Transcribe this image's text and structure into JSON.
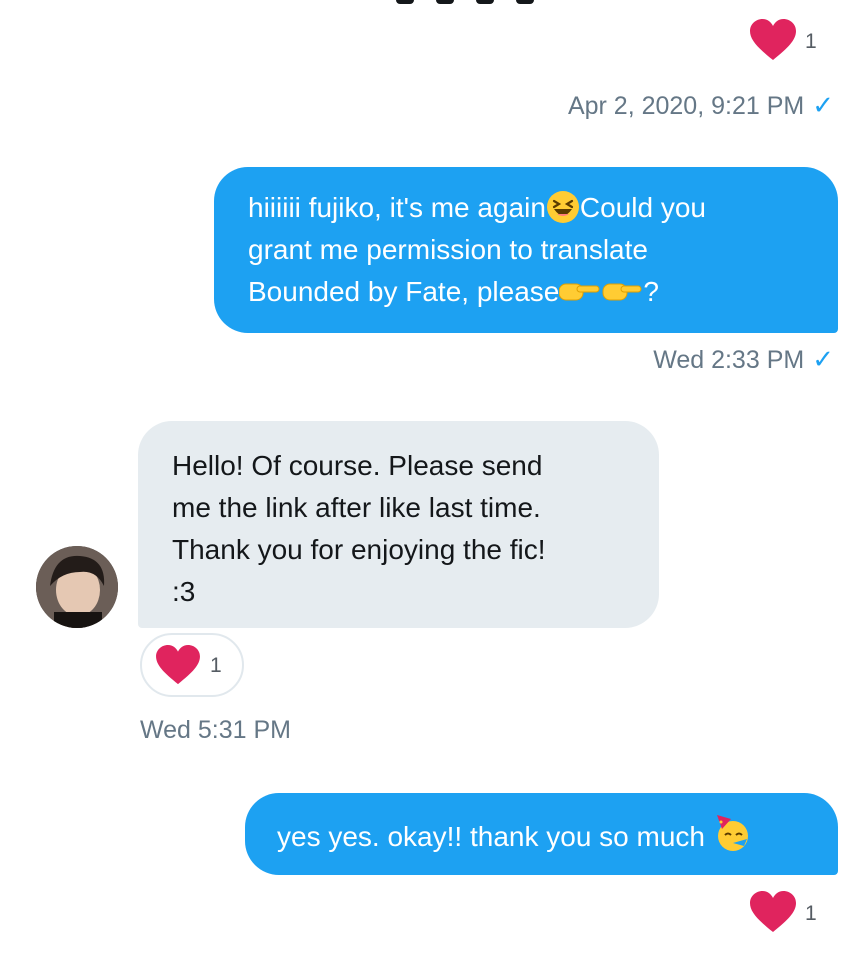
{
  "messages": [
    {
      "id": "m1",
      "direction": "outgoing",
      "lines": [
        [
          "hiiiiii fujiko, it's me again",
          "emoji:grinning-squinting-face",
          "Could you"
        ],
        [
          "grant me permission to translate"
        ],
        [
          "Bounded by Fate, please",
          "emoji:pointing-hands",
          "?"
        ]
      ],
      "timestamp": "Wed 2:33 PM",
      "read_receipt": "checkmark-icon"
    },
    {
      "id": "m2",
      "direction": "incoming",
      "lines": [
        "Hello! Of course. Please send",
        "me the link after like last time.",
        "Thank you for enjoying the fic!",
        ":3"
      ],
      "reaction": {
        "icon": "heart-icon",
        "count": "1"
      },
      "timestamp": "Wed 5:31 PM"
    },
    {
      "id": "m3",
      "direction": "outgoing",
      "text": "yes yes. okay!! thank you so much",
      "emoji": "partying-face",
      "reaction": {
        "icon": "heart-icon",
        "count": "1"
      }
    }
  ],
  "prior_message": {
    "reaction": {
      "icon": "heart-icon",
      "count": "1"
    },
    "timestamp": "Apr 2, 2020, 9:21 PM",
    "read_receipt": "checkmark-icon"
  },
  "user_text_fragments": {
    "m1_l1a": "hiiiiii fujiko, it's me again",
    "m1_l1b": "Could you",
    "m1_l2": "grant me permission to translate",
    "m1_l3a": "Bounded by Fate, please",
    "m1_l3b": "?"
  },
  "colors": {
    "outgoing_bubble": "#1da1f2",
    "incoming_bubble": "#e6ecf0",
    "heart": "#e0245e",
    "timestamp": "#657786",
    "check": "#1da1f2"
  }
}
